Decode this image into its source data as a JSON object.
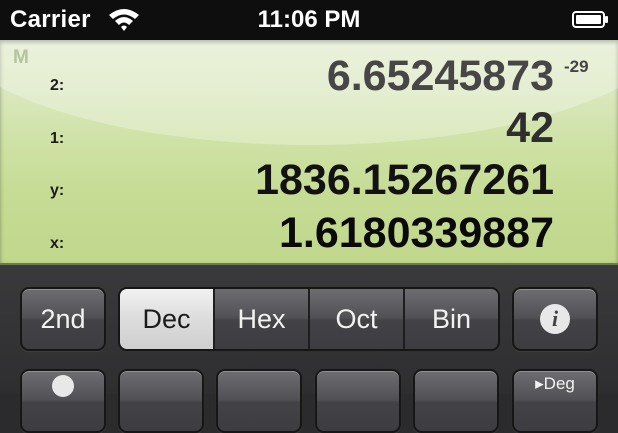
{
  "status_bar": {
    "carrier": "Carrier",
    "time": "11:06 PM"
  },
  "display": {
    "memory_indicator": "M",
    "registers": [
      {
        "label": "2:",
        "value": "6.65245873",
        "exponent": "-29"
      },
      {
        "label": "1:",
        "value": "42",
        "exponent": ""
      },
      {
        "label": "y:",
        "value": "1836.15267261",
        "exponent": ""
      },
      {
        "label": "x:",
        "value": "1.6180339887",
        "exponent": ""
      }
    ]
  },
  "keypad": {
    "second_label": "2nd",
    "base_modes": [
      "Dec",
      "Hex",
      "Oct",
      "Bin"
    ],
    "active_base": "Dec",
    "info_icon": "info-icon",
    "info_label": "i",
    "partial_row": {
      "angle_label": "Deg"
    }
  }
}
